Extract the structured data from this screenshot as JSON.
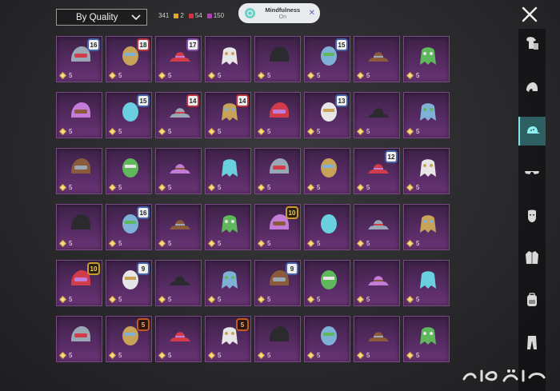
{
  "header": {
    "sort_label": "By Quality",
    "counts": [
      {
        "value": "341",
        "color": ""
      },
      {
        "value": "2",
        "color": "#e2a53a"
      },
      {
        "value": "54",
        "color": "#d3333f"
      },
      {
        "value": "150",
        "color": "#b43bb8"
      }
    ]
  },
  "notification": {
    "title": "Mindfulness",
    "status": "On"
  },
  "items": [
    {
      "badge": "16",
      "badge_style": "blue",
      "qty": "5",
      "icon": "goggle-cap-icon"
    },
    {
      "badge": "18",
      "badge_style": "red",
      "qty": "5",
      "icon": "gas-mask-cap-icon"
    },
    {
      "badge": "17",
      "badge_style": "purple",
      "qty": "5",
      "icon": "hooded-mask-icon"
    },
    {
      "badge": "",
      "badge_style": "",
      "qty": "5",
      "icon": "dreadlock-mask-icon"
    },
    {
      "badge": "",
      "badge_style": "",
      "qty": "5",
      "icon": "dark-hood-icon"
    },
    {
      "badge": "15",
      "badge_style": "blue",
      "qty": "5",
      "icon": "silver-helmet-icon"
    },
    {
      "badge": "",
      "badge_style": "",
      "qty": "5",
      "icon": "gold-armored-helmet-icon"
    },
    {
      "badge": "",
      "badge_style": "",
      "qty": "5",
      "icon": "spiked-helmet-icon"
    },
    {
      "badge": "",
      "badge_style": "",
      "qty": "5",
      "icon": "red-hat-icon"
    },
    {
      "badge": "15",
      "badge_style": "blue",
      "qty": "5",
      "icon": "white-mask-helmet-icon"
    },
    {
      "badge": "14",
      "badge_style": "red",
      "qty": "5",
      "icon": "officer-cap-icon"
    },
    {
      "badge": "14",
      "badge_style": "red",
      "qty": "5",
      "icon": "red-officer-cap-icon"
    },
    {
      "badge": "",
      "badge_style": "",
      "qty": "5",
      "icon": "pink-visor-helmet-icon"
    },
    {
      "badge": "13",
      "badge_style": "blue",
      "qty": "5",
      "icon": "samurai-helmet-icon"
    },
    {
      "badge": "",
      "badge_style": "",
      "qty": "5",
      "icon": "black-helmet-icon"
    },
    {
      "badge": "",
      "badge_style": "",
      "qty": "5",
      "icon": "horned-mask-icon"
    },
    {
      "badge": "",
      "badge_style": "",
      "qty": "5",
      "icon": "sheep-mask-icon"
    },
    {
      "badge": "",
      "badge_style": "",
      "qty": "5",
      "icon": "box-head-icon"
    },
    {
      "badge": "",
      "badge_style": "",
      "qty": "5",
      "icon": "frog-cap-icon"
    },
    {
      "badge": "",
      "badge_style": "",
      "qty": "5",
      "icon": "red-beanie-icon"
    },
    {
      "badge": "",
      "badge_style": "",
      "qty": "5",
      "icon": "goggles-icon"
    },
    {
      "badge": "",
      "badge_style": "",
      "qty": "5",
      "icon": "sunglasses-icon"
    },
    {
      "badge": "12",
      "badge_style": "blue",
      "qty": "5",
      "icon": "gas-mask-icon"
    },
    {
      "badge": "",
      "badge_style": "",
      "qty": "5",
      "icon": "purple-cap-icon"
    },
    {
      "badge": "",
      "badge_style": "",
      "qty": "5",
      "icon": "pink-cap-icon"
    },
    {
      "badge": "16",
      "badge_style": "blue",
      "qty": "5",
      "icon": "blue-helmet-icon"
    },
    {
      "badge": "",
      "badge_style": "",
      "qty": "5",
      "icon": "black-visor-helmet-icon"
    },
    {
      "badge": "",
      "badge_style": "",
      "qty": "5",
      "icon": "chrome-helmet-icon"
    },
    {
      "badge": "10",
      "badge_style": "gold",
      "qty": "5",
      "icon": "pilot-cap-icon"
    },
    {
      "badge": "",
      "badge_style": "",
      "qty": "5",
      "icon": "white-beanie-icon"
    },
    {
      "badge": "",
      "badge_style": "",
      "qty": "5",
      "icon": "headband-icon"
    },
    {
      "badge": "",
      "badge_style": "",
      "qty": "5",
      "icon": "devil-horns-icon"
    },
    {
      "badge": "10",
      "badge_style": "gold",
      "qty": "5",
      "icon": "red-beret-icon"
    },
    {
      "badge": "9",
      "badge_style": "blue",
      "qty": "5",
      "icon": "silver-hair-icon"
    },
    {
      "badge": "",
      "badge_style": "",
      "qty": "5",
      "icon": "fedora-icon"
    },
    {
      "badge": "",
      "badge_style": "",
      "qty": "5",
      "icon": "crab-hat-icon"
    },
    {
      "badge": "9",
      "badge_style": "blue",
      "qty": "5",
      "icon": "gold-skull-mask-icon"
    },
    {
      "badge": "",
      "badge_style": "",
      "qty": "5",
      "icon": "top-hat-icon"
    },
    {
      "badge": "",
      "badge_style": "",
      "qty": "5",
      "icon": "straw-hat-icon"
    },
    {
      "badge": "",
      "badge_style": "",
      "qty": "5",
      "icon": "chef-hat-icon"
    },
    {
      "badge": "",
      "badge_style": "",
      "qty": "5",
      "icon": "ice-dragon-mask-icon"
    },
    {
      "badge": "5",
      "badge_style": "orange",
      "qty": "5",
      "icon": "spiked-tiara-icon"
    },
    {
      "badge": "",
      "badge_style": "",
      "qty": "5",
      "icon": "cat-ears-icon"
    },
    {
      "badge": "5",
      "badge_style": "orange",
      "qty": "5",
      "icon": "skull-dragon-mask-icon"
    },
    {
      "badge": "",
      "badge_style": "",
      "qty": "5",
      "icon": "green-monster-mask-icon"
    },
    {
      "badge": "",
      "badge_style": "",
      "qty": "5",
      "icon": "antlers-icon"
    },
    {
      "badge": "",
      "badge_style": "",
      "qty": "5",
      "icon": "cowboy-hat-icon"
    },
    {
      "badge": "",
      "badge_style": "",
      "qty": "5",
      "icon": "bowler-hat-icon"
    }
  ],
  "sidebar": [
    {
      "name": "outfit-category-icon",
      "active": false
    },
    {
      "name": "helmet-category-icon",
      "active": false
    },
    {
      "name": "hat-category-icon",
      "active": true
    },
    {
      "name": "glasses-category-icon",
      "active": false
    },
    {
      "name": "mask-category-icon",
      "active": false
    },
    {
      "name": "jacket-category-icon",
      "active": false
    },
    {
      "name": "backpack-category-icon",
      "active": false
    },
    {
      "name": "pants-category-icon",
      "active": false
    }
  ]
}
